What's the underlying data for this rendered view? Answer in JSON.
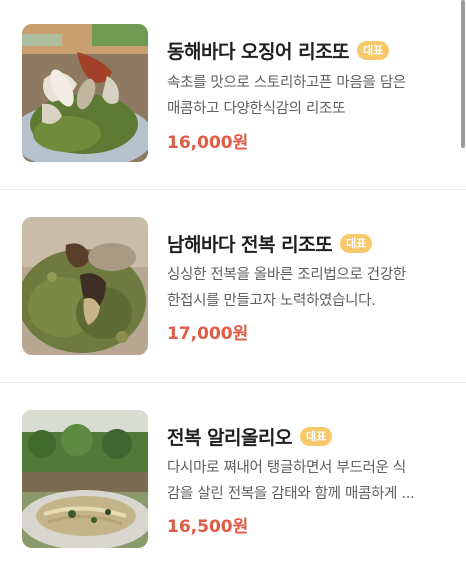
{
  "menu": {
    "items": [
      {
        "name": "동해바다 오징어 리조또",
        "badge": "대표",
        "description_line1": "속초를 맛으로 스토리하고픈 마음을 담은",
        "description_line2": "매콤하고 다양한식감의 리조또",
        "price": "16,000원"
      },
      {
        "name": "남해바다 전복 리조또",
        "badge": "대표",
        "description_line1": "싱싱한 전복을 올바른 조리법으로 건강한",
        "description_line2": "한접시를 만들고자 노력하였습니다.",
        "price": "17,000원"
      },
      {
        "name": "전복 알리올리오",
        "badge": "대표",
        "description_line1": "다시마로 쪄내어 탱글하면서 부드러운 식",
        "description_line2": "감을 살린 전복을 감태와 함께 매콤하게 ...",
        "price": "16,500원"
      }
    ]
  },
  "colors": {
    "price": "#df5b45",
    "badge": "#f7c96b",
    "title": "#1f1f1f",
    "description": "#5f5f5f"
  }
}
